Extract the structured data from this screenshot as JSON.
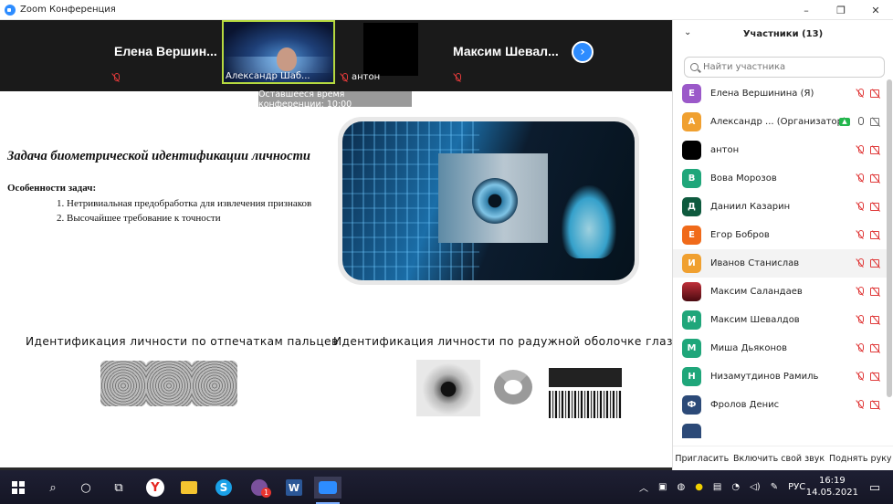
{
  "window": {
    "title": "Zoom Конференция",
    "controls": [
      "–",
      "❐",
      "✕"
    ]
  },
  "video_strip": {
    "tiles": [
      {
        "name": "Елена  Вершин...",
        "label": ""
      },
      {
        "name": "",
        "label": "Александр Шаб..."
      },
      {
        "name": "",
        "label": "антон"
      },
      {
        "name": "Максим  Шевал...",
        "label": ""
      }
    ],
    "next_button": "›",
    "timer": "Оставшееся время конференции: 10:00"
  },
  "slide": {
    "title": "Задача биометрической идентификации личности",
    "features_title": "Особенности задач:",
    "features": [
      "1. Нетривиальная предобработка для извлечения признаков",
      "2. Высочайшее требование к точности"
    ],
    "captions": [
      "Идентификация личности по отпечаткам пальцев",
      "Идентификация личности по радужной оболочке глаза"
    ]
  },
  "participants": {
    "header": "Участники (13)",
    "search_placeholder": "Найти участника",
    "people": [
      {
        "initial": "Е",
        "name": "Елена Вершинина (Я)",
        "color": "#9b59c9"
      },
      {
        "initial": "А",
        "name": "Александр ... (Организатор)",
        "color": "#f0a030"
      },
      {
        "initial": "",
        "name": "антон",
        "color": "#000000"
      },
      {
        "initial": "В",
        "name": "Вова Морозов",
        "color": "#1fa67a"
      },
      {
        "initial": "Д",
        "name": "Даниил Казарин",
        "color": "#0e5a3e"
      },
      {
        "initial": "Е",
        "name": "Егор Бобров",
        "color": "#f06a1a"
      },
      {
        "initial": "И",
        "name": "Иванов Станислав",
        "color": "#f0a030"
      },
      {
        "initial": "",
        "name": "Максим Саландаев",
        "color": "#9a2030"
      },
      {
        "initial": "М",
        "name": "Максим Шевалдов",
        "color": "#1fa67a"
      },
      {
        "initial": "М",
        "name": "Миша Дьяконов",
        "color": "#1fa67a"
      },
      {
        "initial": "Н",
        "name": "Низамутдинов Рамиль",
        "color": "#1fa67a"
      },
      {
        "initial": "Ф",
        "name": "Фролов Денис",
        "color": "#2c4a78"
      },
      {
        "initial": "",
        "name": "",
        "color": "#2c4a78"
      }
    ],
    "footer": {
      "invite": "Пригласить",
      "unmute": "Включить свой звук",
      "raise_hand": "Поднять руку"
    }
  },
  "taskbar": {
    "icons": [
      "windows-start",
      "search",
      "cortana",
      "task-view",
      "yandex-browser",
      "file-explorer",
      "skype",
      "viber",
      "word",
      "zoom"
    ],
    "viber_badge": "1",
    "language": "РУС",
    "time": "16:19",
    "date": "14.05.2021"
  }
}
